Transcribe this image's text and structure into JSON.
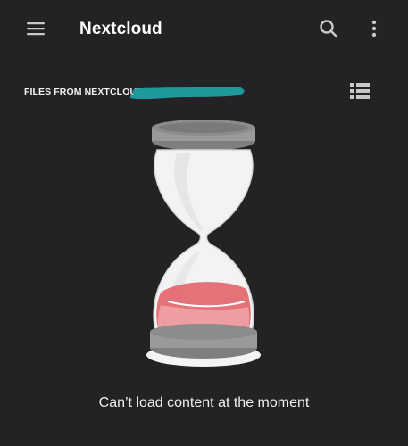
{
  "app_bar": {
    "title": "Nextcloud",
    "menu_icon": "hamburger-menu-icon",
    "search_icon": "search-icon",
    "more_icon": "more-vertical-icon"
  },
  "breadcrumb": {
    "path_label": "FILES FROM NEXTCLOUD/",
    "list_view_icon": "list-view-icon"
  },
  "empty_state": {
    "illustration": "hourglass-icon",
    "message": "Can’t load content at the moment"
  },
  "colors": {
    "background": "#232326",
    "text": "#ffffff",
    "icon": "#c8c8c8",
    "redaction": "#1f9a9c",
    "sand": "#e3646a"
  }
}
